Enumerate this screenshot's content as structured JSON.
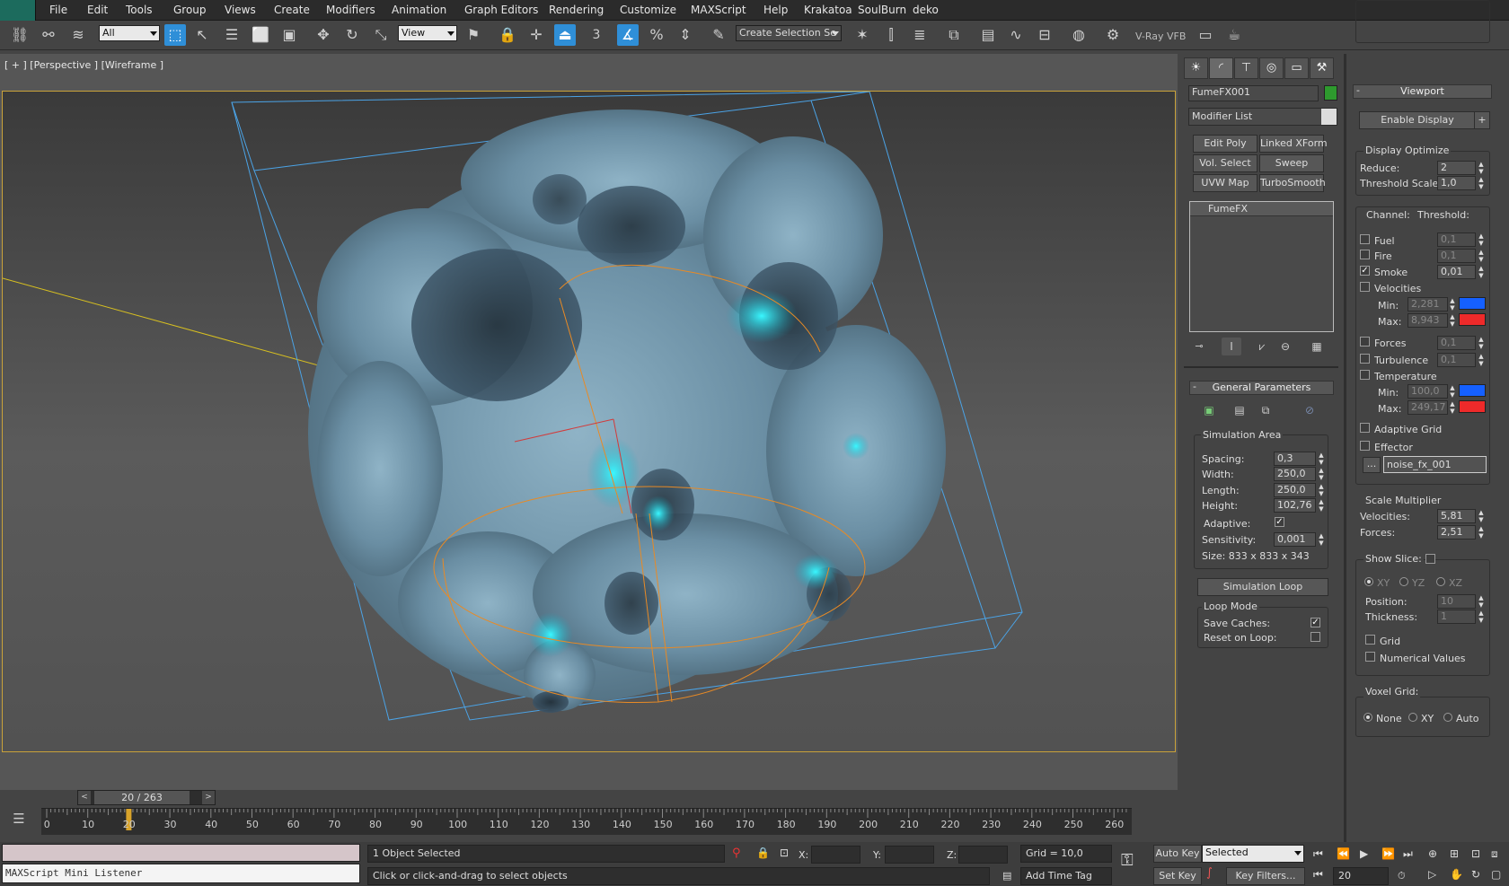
{
  "menu": [
    "File",
    "Edit",
    "Tools",
    "Group",
    "Views",
    "Create",
    "Modifiers",
    "Animation",
    "Graph Editors",
    "Rendering",
    "Customize",
    "MAXScript",
    "Help",
    "Krakatoa",
    "SoulBurn",
    "deko"
  ],
  "toolbar": {
    "selection_filter": "All",
    "ref_coord": "View",
    "snap_angle_label": "3",
    "named_selection_placeholder": "Create Selection Se",
    "vray_label": "V-Ray VFB"
  },
  "viewport": {
    "label": "[ + ] [Perspective ] [Wireframe ]"
  },
  "modify": {
    "object_name": "FumeFX001",
    "object_color": "#2e9a2e",
    "modifier_list": "Modifier List",
    "modifier_buttons": [
      "Edit Poly",
      "Linked XForm",
      "Vol. Select",
      "Sweep",
      "UVW Map",
      "TurboSmooth"
    ],
    "stack": [
      "FumeFX"
    ]
  },
  "general": {
    "title": "General Parameters",
    "sim_area": "Simulation Area",
    "spacing_label": "Spacing:",
    "spacing": "0,3",
    "width_label": "Width:",
    "width": "250,0",
    "length_label": "Length:",
    "length": "250,0",
    "height_label": "Height:",
    "height": "102,76",
    "adaptive_label": "Adaptive:",
    "sensitivity_label": "Sensitivity:",
    "sensitivity": "0,001",
    "size": "Size:  833 x 833 x 343",
    "sim_loop": "Simulation Loop",
    "loop_mode": "Loop Mode",
    "save_caches": "Save Caches:",
    "reset_on_loop": "Reset on Loop:"
  },
  "vp_panel": {
    "title": "Viewport",
    "enable_display": "Enable Display",
    "plus": "+",
    "display_optimize": "Display Optimize",
    "reduce_label": "Reduce:",
    "reduce": "2",
    "thresh_scale_label": "Threshold Scale:",
    "thresh_scale": "1,0",
    "channel": "Channel:",
    "threshold": "Threshold:",
    "fuel": "Fuel",
    "fuel_v": "0,1",
    "fire": "Fire",
    "fire_v": "0,1",
    "smoke": "Smoke",
    "smoke_v": "0,01",
    "velocities": "Velocities",
    "min_label": "Min:",
    "vel_min": "2,281",
    "max_label": "Max:",
    "vel_max": "8,943",
    "forces": "Forces",
    "forces_v": "0,1",
    "turbulence": "Turbulence",
    "turb_v": "0,1",
    "temperature": "Temperature",
    "temp_min": "100,0",
    "temp_max": "249,17",
    "adaptive_grid": "Adaptive Grid",
    "effector": "Effector",
    "effector_dots": "...",
    "effector_name": "noise_fx_001",
    "scale_mult": "Scale Multiplier",
    "sm_vel_label": "Velocities:",
    "sm_vel": "5,81",
    "sm_forces_label": "Forces:",
    "sm_forces": "2,51",
    "show_slice": "Show Slice:",
    "xy": "XY",
    "yz": "YZ",
    "xz": "XZ",
    "position_label": "Position:",
    "position": "10",
    "thickness_label": "Thickness:",
    "thickness": "1",
    "grid": "Grid",
    "numerical": "Numerical Values",
    "voxel_grid": "Voxel Grid:",
    "none": "None",
    "vxy": "XY",
    "auto": "Auto",
    "colors": {
      "min_blue": "#1560ff",
      "max_red": "#ee2a2a"
    }
  },
  "timeline": {
    "frame": "20 / 263",
    "current_frame": 20,
    "total_frames": 263,
    "ticks": [
      "0",
      "10",
      "20",
      "30",
      "40",
      "50",
      "60",
      "70",
      "80",
      "90",
      "100",
      "110",
      "120",
      "130",
      "140",
      "150",
      "160",
      "170",
      "180",
      "190",
      "200",
      "210",
      "220",
      "230",
      "240",
      "250",
      "260"
    ]
  },
  "status": {
    "listener": "MAXScript Mini Listener",
    "selected": "1 Object Selected",
    "prompt": "Click or click-and-drag to select objects",
    "x_label": "X:",
    "y_label": "Y:",
    "z_label": "Z:",
    "grid": "Grid = 10,0",
    "add_time_tag": "Add Time Tag",
    "auto_key": "Auto Key",
    "set_key": "Set Key",
    "key_mode": "Selected",
    "key_filters": "Key Filters...",
    "frame_field": "20"
  }
}
